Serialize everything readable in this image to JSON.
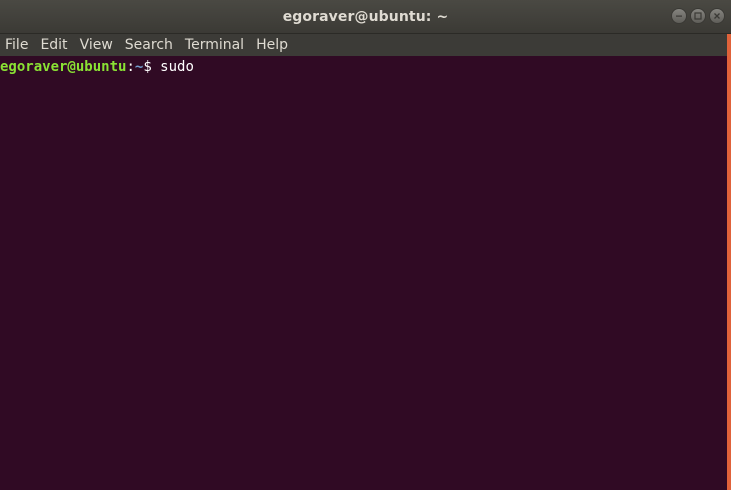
{
  "window": {
    "title": "egoraver@ubuntu: ~"
  },
  "window_controls": {
    "minimize_icon": "minimize-icon",
    "maximize_icon": "maximize-icon",
    "close_icon": "close-icon"
  },
  "menu": {
    "items": [
      {
        "label": "File"
      },
      {
        "label": "Edit"
      },
      {
        "label": "View"
      },
      {
        "label": "Search"
      },
      {
        "label": "Terminal"
      },
      {
        "label": "Help"
      }
    ]
  },
  "terminal": {
    "prompt_user_host": "egoraver@ubuntu",
    "prompt_colon": ":",
    "prompt_path": "~",
    "prompt_symbol": "$ ",
    "command": "sudo"
  },
  "colors": {
    "terminal_bg": "#300a24",
    "prompt_user": "#8ae234",
    "prompt_path": "#729fcf",
    "accent": "#e0623a"
  }
}
